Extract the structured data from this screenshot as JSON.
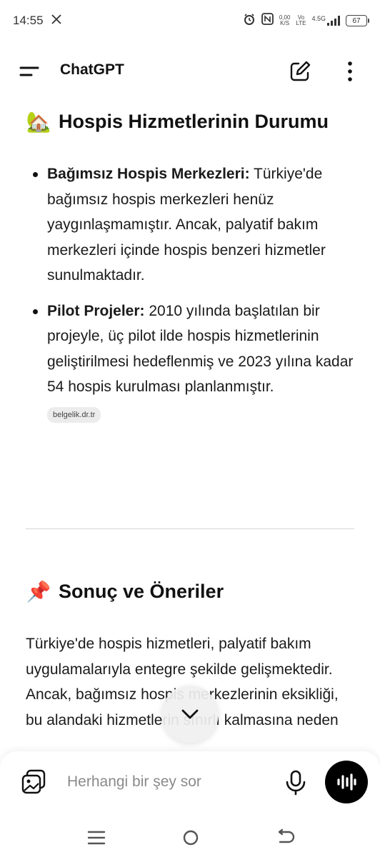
{
  "status_bar": {
    "time": "14:55",
    "x_icon": "x-logo-icon",
    "net_speed_top": "0,00",
    "net_speed_bottom": "K/S",
    "volte_top": "Vo",
    "volte_bottom": "LTE",
    "network": "4.5G",
    "battery": "67"
  },
  "header": {
    "title": "ChatGPT",
    "menu_icon": "menu-icon",
    "edit_icon": "new-chat-icon",
    "more_icon": "more-vertical-icon"
  },
  "sections": [
    {
      "emoji": "🏡",
      "heading": "Hospis Hizmetlerinin Durumu",
      "bullets": [
        {
          "title": "Bağımsız Hospis Merkezleri:",
          "text": " Türkiye'de bağımsız hospis merkezleri henüz yaygınlaşmamıştır.  Ancak, palyatif bakım merkezleri içinde hospis benzeri hizmetler sunulmaktadır."
        },
        {
          "title": "Pilot Projeler:",
          "text": " 2010 yılında başlatılan bir projeyle, üç pilot ilde hospis hizmetlerinin geliştirilmesi hedeflenmiş ve 2023 yılına kadar 54 hospis kurulması planlanmıştır."
        }
      ],
      "source": "belgelik.dr.tr"
    },
    {
      "emoji": "📌",
      "heading": "Sonuç ve Öneriler",
      "paragraph": "Türkiye'de hospis hizmetleri, palyatif bakım uygulamalarıyla entegre şekilde gelişmektedir.  Ancak, bağımsız hospis merkezlerinin eksikliği, bu alandaki hizmetlerin sınırlı kalmasına neden"
    }
  ],
  "composer": {
    "placeholder": "Herhangi bir şey sor",
    "attach_icon": "image-attach-icon",
    "mic_icon": "microphone-icon",
    "voice_icon": "voice-mode-icon"
  },
  "scroll_button_icon": "chevron-down-icon",
  "nav": {
    "recents_icon": "recent-apps-icon",
    "home_icon": "home-icon",
    "back_icon": "back-icon"
  }
}
